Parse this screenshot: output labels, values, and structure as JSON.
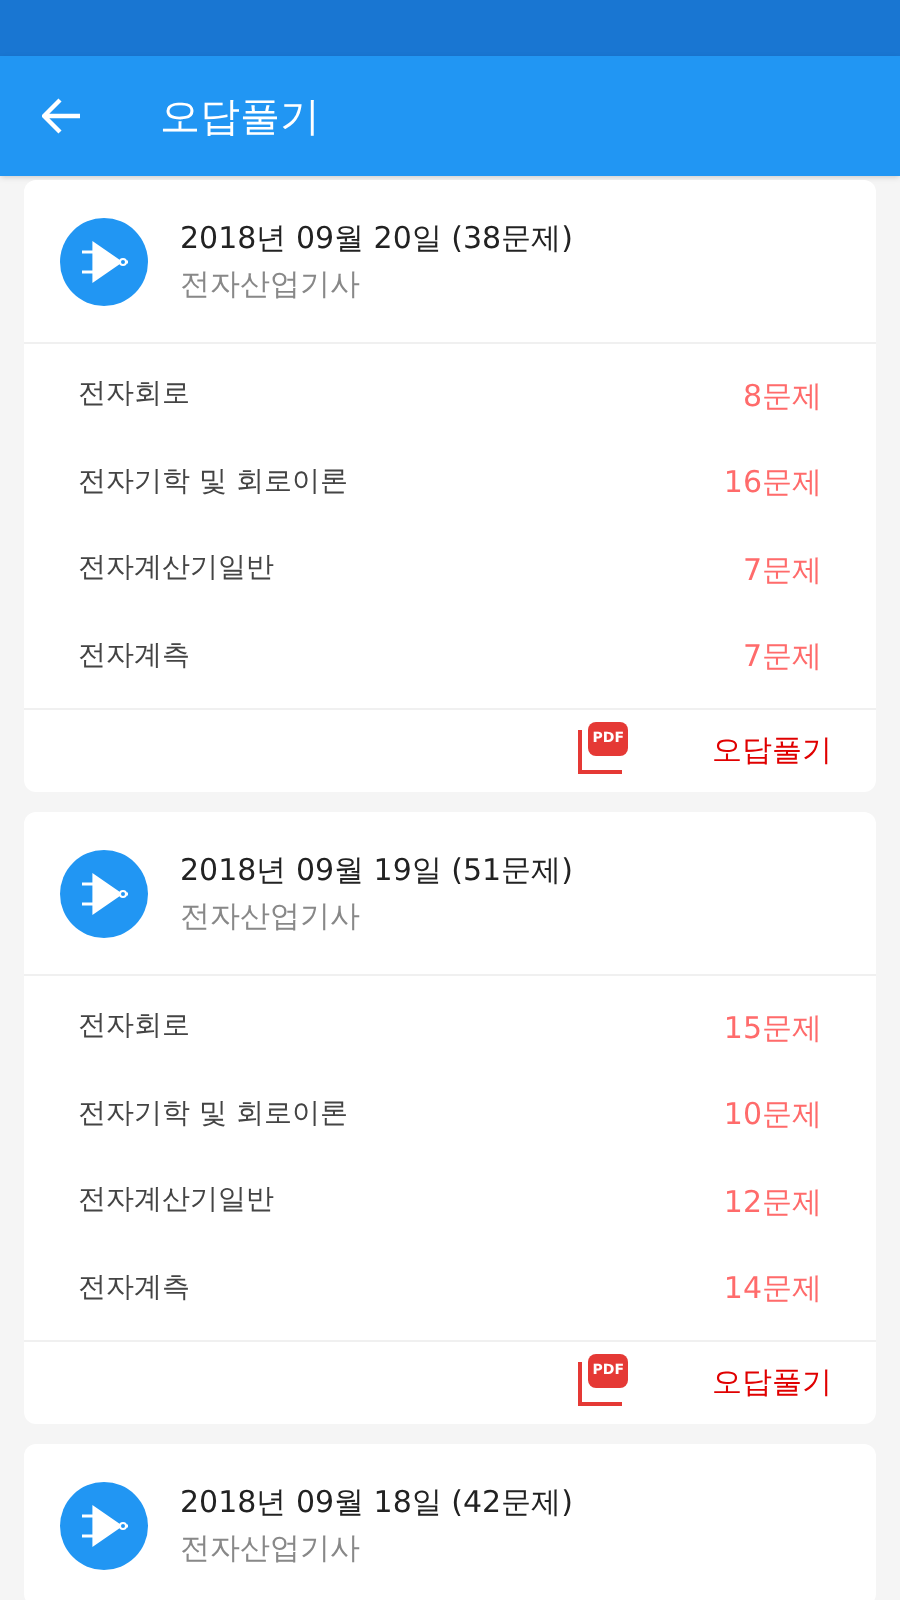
{
  "app_bar": {
    "title": "오답풀기"
  },
  "cards": [
    {
      "date": "2018년 09월 20일 (38문제)",
      "subject": "전자산업기사",
      "rows": [
        {
          "name": "전자회로",
          "count": "8문제"
        },
        {
          "name": "전자기학 및 회로이론",
          "count": "16문제"
        },
        {
          "name": "전자계산기일반",
          "count": "7문제"
        },
        {
          "name": "전자계측",
          "count": "7문제"
        }
      ],
      "pdf_label": "PDF",
      "action": "오답풀기"
    },
    {
      "date": "2018년 09월 19일 (51문제)",
      "subject": "전자산업기사",
      "rows": [
        {
          "name": "전자회로",
          "count": "15문제"
        },
        {
          "name": "전자기학 및 회로이론",
          "count": "10문제"
        },
        {
          "name": "전자계산기일반",
          "count": "12문제"
        },
        {
          "name": "전자계측",
          "count": "14문제"
        }
      ],
      "pdf_label": "PDF",
      "action": "오답풀기"
    },
    {
      "date": "2018년 09월 18일 (42문제)",
      "subject": "전자산업기사"
    }
  ]
}
